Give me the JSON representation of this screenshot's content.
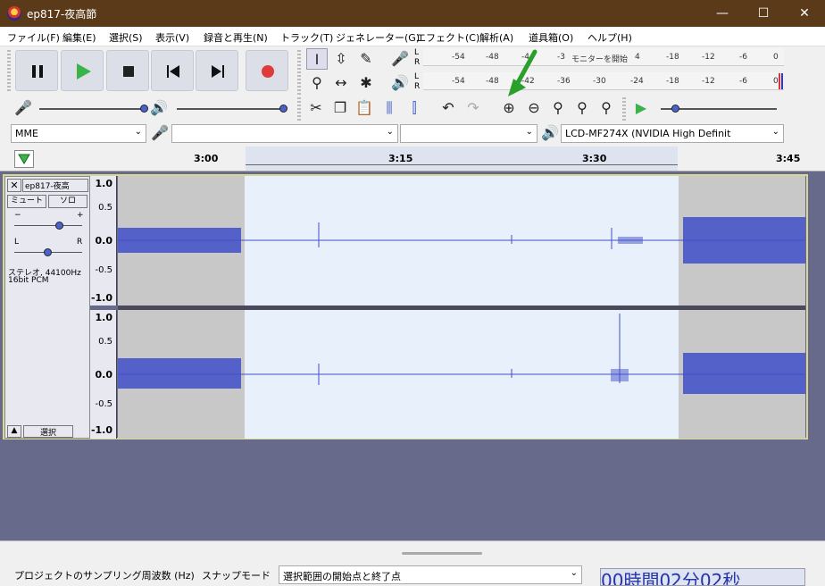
{
  "window": {
    "title": "ep817-夜高節",
    "minimize": "—",
    "maximize": "☐",
    "close": "✕"
  },
  "menu": {
    "items": [
      "ファイル(F)",
      "編集(E)",
      "選択(S)",
      "表示(V)",
      "録音と再生(N)",
      "トラック(T)",
      "ジェネレーター(G)",
      "エフェクト(C)",
      "解析(A)",
      "道具箱(O)",
      "ヘルプ(H)"
    ]
  },
  "meters": {
    "record_scale": [
      "-54",
      "-48",
      "-4",
      "-3",
      "モニターを開始",
      "4",
      "-18",
      "-12",
      "-6",
      "0"
    ],
    "play_scale": [
      "-54",
      "-48",
      "-42",
      "-36",
      "-30",
      "-24",
      "-18",
      "-12",
      "-6",
      "0"
    ],
    "channel_l": "L",
    "channel_r": "R"
  },
  "device": {
    "host": "MME",
    "output": "LCD-MF274X (NVIDIA High Definit"
  },
  "ruler": {
    "ticks": [
      "3:00",
      "3:15",
      "3:30",
      "3:45"
    ]
  },
  "track": {
    "name": "ep817-夜高",
    "mute": "ミュート",
    "solo": "ソロ",
    "gain_minus": "−",
    "gain_plus": "+",
    "pan_l": "L",
    "pan_r": "R",
    "info_line1": "ステレオ, 44100Hz",
    "info_line2": "16bit PCM",
    "select": "選択",
    "scale": [
      "1.0",
      "0.5",
      "0.0",
      "-0.5",
      "-1.0"
    ]
  },
  "bottom": {
    "rate_label": "プロジェクトのサンプリング周波数 (Hz)",
    "snap_label": "スナップモード",
    "selection_label": "選択範囲の開始点と終了点",
    "time_display": "00時間02分02秒"
  },
  "colors": {
    "titlebar": "#5b3a1a",
    "waveform": "#3f4fc9",
    "selection_bg": "#e8f0fb",
    "annotation_arrow": "#2aa02a"
  }
}
